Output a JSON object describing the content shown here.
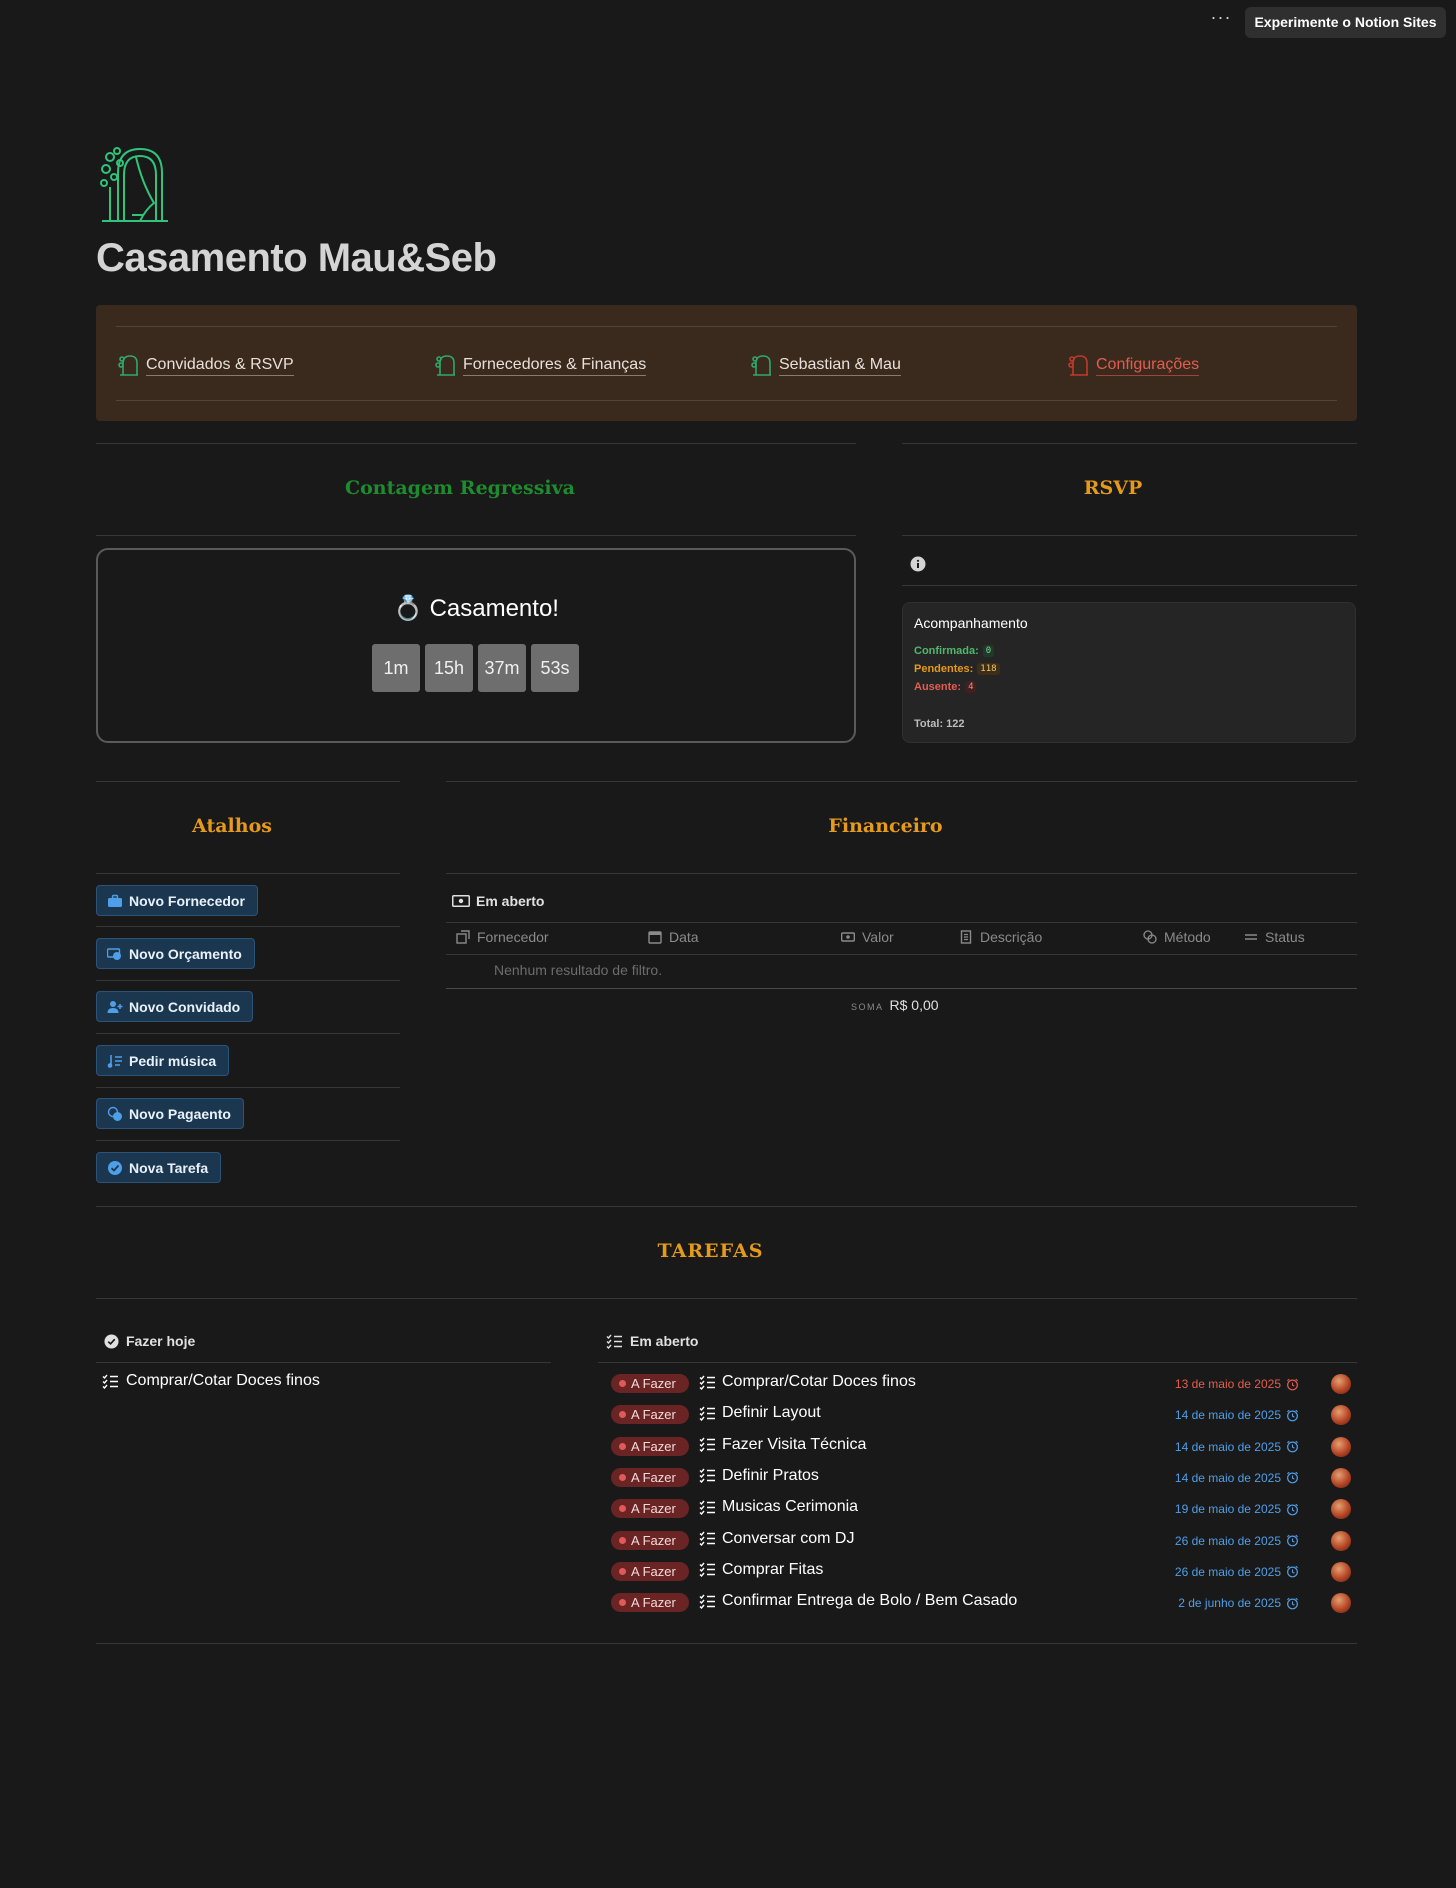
{
  "topbar": {
    "more_label": "···",
    "cta_label": "Experimente o Notion Sites"
  },
  "page": {
    "icon": "wedding-arch-icon",
    "title": "Casamento Mau&Seb"
  },
  "nav": {
    "items": [
      {
        "label": "Convidados & RSVP",
        "icon": "arch-icon"
      },
      {
        "label": "Fornecedores & Finanças",
        "icon": "arch-icon"
      },
      {
        "label": "Sebastian & Mau",
        "icon": "arch-icon"
      },
      {
        "label": "Configurações",
        "icon": "arch-icon"
      }
    ]
  },
  "countdown": {
    "section_title": "Contagem Regressiva",
    "title": "💍 Casamento!",
    "months": "1m",
    "hours": "15h",
    "minutes": "37m",
    "seconds": "53s"
  },
  "rsvp": {
    "section_title": "RSVP",
    "card_title": "Acompanhamento",
    "confirmed_label": "Confirmada:",
    "confirmed_value": "0",
    "pending_label": "Pendentes:",
    "pending_value": "118",
    "absent_label": "Ausente:",
    "absent_value": "4",
    "total": "Total: 122"
  },
  "shortcuts": {
    "section_title": "Atalhos",
    "items": [
      {
        "label": "Novo Fornecedor",
        "icon": "briefcase-icon"
      },
      {
        "label": "Novo Orçamento",
        "icon": "money-icon"
      },
      {
        "label": "Novo Convidado",
        "icon": "add-person-icon"
      },
      {
        "label": "Pedir música",
        "icon": "music-icon"
      },
      {
        "label": "Novo Pagaento",
        "icon": "coins-icon"
      },
      {
        "label": "Nova Tarefa",
        "icon": "check-circle-icon"
      }
    ]
  },
  "finance": {
    "section_title": "Financeiro",
    "view_label": "Em aberto",
    "columns": [
      "Fornecedor",
      "Data",
      "Valor",
      "Descrição",
      "Método",
      "Status"
    ],
    "empty_text": "Nenhum resultado de filtro.",
    "sum_label": "SOMA",
    "sum_value": "R$ 0,00"
  },
  "tasks": {
    "section_title": "TAREFAS",
    "today_label": "Fazer hoje",
    "today_items": [
      "Comprar/Cotar Doces finos"
    ],
    "open_label": "Em aberto",
    "status_label": "A Fazer",
    "items": [
      {
        "name": "Comprar/Cotar Doces finos",
        "date": "13 de maio de 2025",
        "overdue": true
      },
      {
        "name": "Definir Layout",
        "date": "14 de maio de 2025",
        "overdue": false
      },
      {
        "name": "Fazer Visita Técnica",
        "date": "14 de maio de 2025",
        "overdue": false
      },
      {
        "name": "Definir Pratos",
        "date": "14 de maio de 2025",
        "overdue": false
      },
      {
        "name": "Musicas Cerimonia",
        "date": "19 de maio de 2025",
        "overdue": false
      },
      {
        "name": "Conversar com DJ",
        "date": "26 de maio de 2025",
        "overdue": false
      },
      {
        "name": "Comprar Fitas",
        "date": "26 de maio de 2025",
        "overdue": false
      },
      {
        "name": "Confirmar Entrega de Bolo / Bem Casado",
        "date": "2 de junho de 2025",
        "overdue": false
      }
    ]
  },
  "colors": {
    "background": "#191919",
    "nav_panel": "#3a2a1e",
    "countdown_title": "#1e8c2e",
    "section_title_orange": "#e59a1c",
    "shortcut_bg": "#1b3750",
    "accent_blue": "#4f9fe8",
    "overdue_red": "#e35d4f",
    "confirmed_green": "#4fb86a",
    "pending_orange": "#e59a1c",
    "absent_red": "#e35d4f"
  }
}
